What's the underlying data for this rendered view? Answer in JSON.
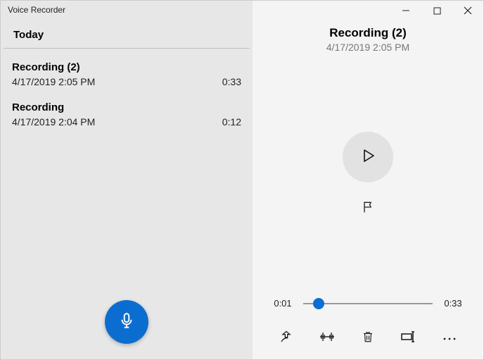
{
  "appTitle": "Voice Recorder",
  "sectionHeader": "Today",
  "recordings": [
    {
      "name": "Recording (2)",
      "datetime": "4/17/2019 2:05 PM",
      "duration": "0:33"
    },
    {
      "name": "Recording",
      "datetime": "4/17/2019 2:04 PM",
      "duration": "0:12"
    }
  ],
  "playback": {
    "title": "Recording (2)",
    "subtitle": "4/17/2019 2:05 PM",
    "elapsed": "0:01",
    "total": "0:33",
    "progressPercent": 12
  }
}
